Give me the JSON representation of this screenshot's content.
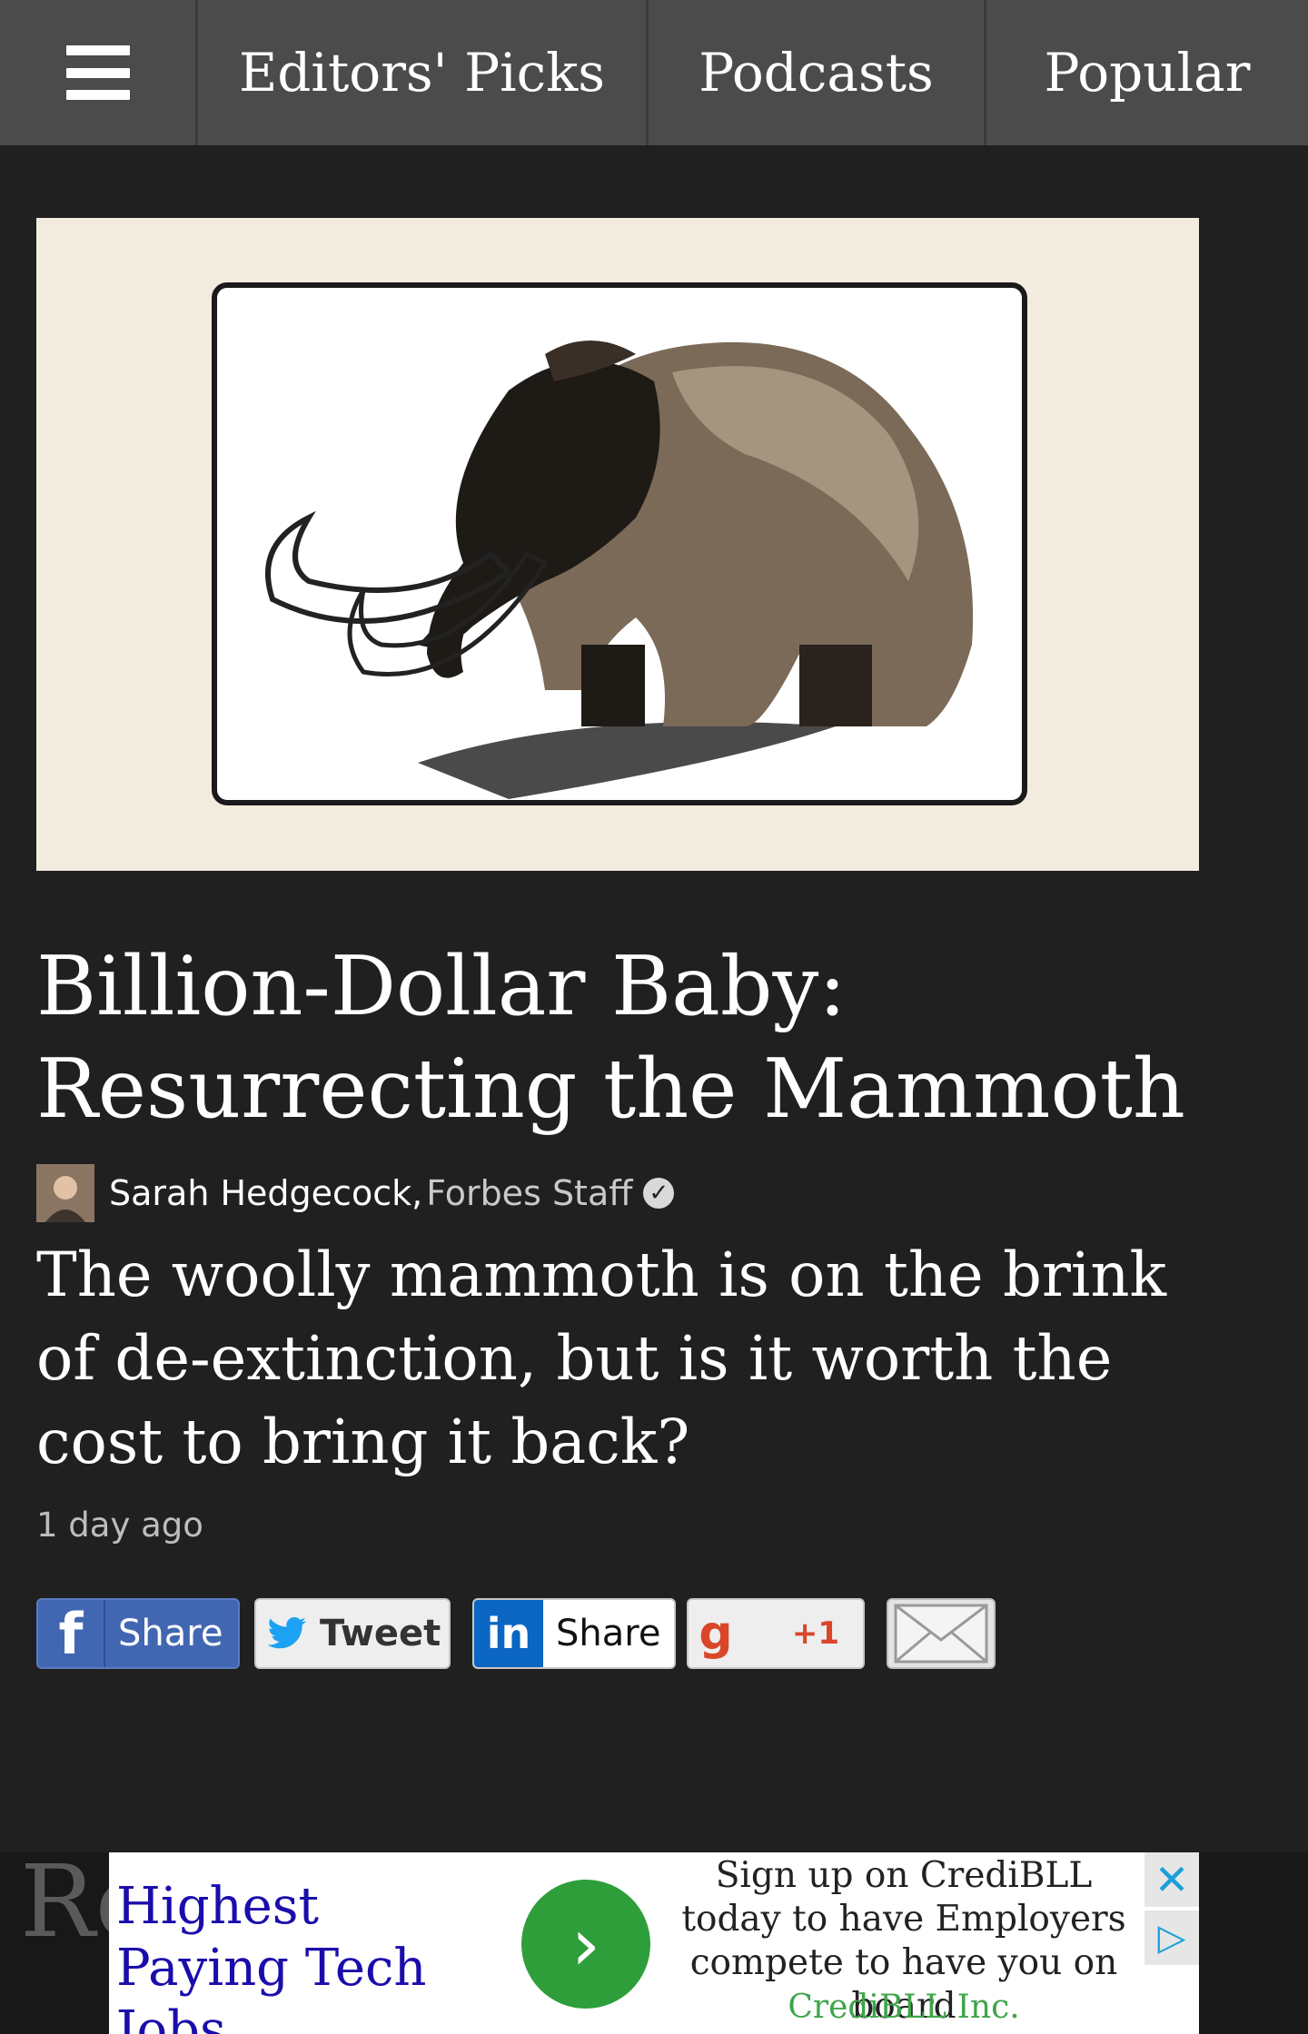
{
  "nav": {
    "menu_icon": "hamburger-menu-icon",
    "items": [
      {
        "label": "Editors' Picks"
      },
      {
        "label": "Podcasts"
      },
      {
        "label": "Popular"
      }
    ]
  },
  "article": {
    "headline": "Billion-Dollar Baby: Resurrecting the Mammoth",
    "author": "Sarah Hedgecock",
    "author_separator": ",",
    "author_role": "Forbes Staff",
    "verified_icon": "verified-check-icon",
    "dek": "The woolly mammoth is on the brink of de-extinction, but is it worth the cost to bring it back?",
    "timestamp": "1 day ago"
  },
  "share": {
    "facebook": {
      "icon": "f",
      "label": "Share"
    },
    "twitter": {
      "icon": "twitter-bird-icon",
      "label": "Tweet"
    },
    "linkedin": {
      "icon": "in",
      "label": "Share"
    },
    "google_plus": {
      "icon": "g",
      "label": "+1"
    },
    "email": {
      "icon": "envelope-icon"
    }
  },
  "section": {
    "title_partial": "Re"
  },
  "ad": {
    "headline": "Highest Paying Tech Jobs",
    "body": "Sign up on CrediBLL today to have Employers compete to have you on board",
    "sponsor": "CrediBLL Inc.",
    "close_symbol": "✕",
    "info_symbol": "▷",
    "cta_symbol": "›"
  },
  "colors": {
    "page_bg": "#202020",
    "nav_bg": "#4b4b4b",
    "ad_link": "#1a0dab",
    "ad_cta": "#2e9e3b",
    "sponsor": "#3ea54a"
  }
}
